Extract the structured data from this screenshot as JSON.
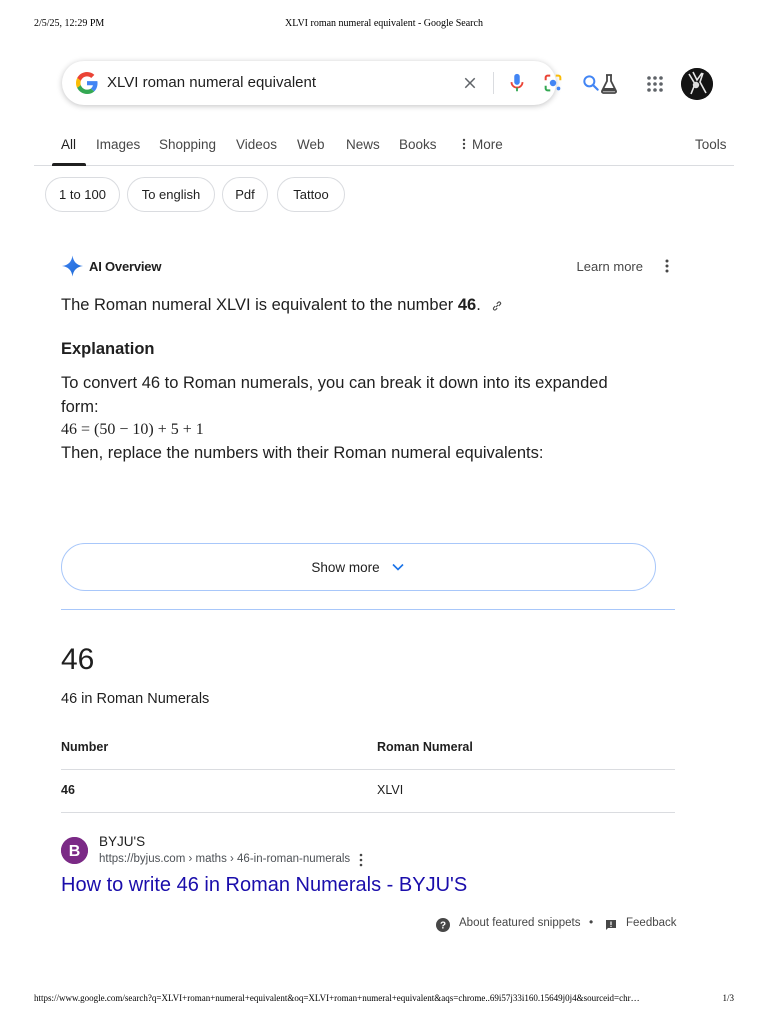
{
  "print_header": {
    "datetime": "2/5/25, 12:29 PM",
    "title": "XLVI roman numeral equivalent - Google Search"
  },
  "search": {
    "query": "XLVI roman numeral equivalent",
    "icons": [
      "google-logo-icon",
      "clear-icon",
      "mic-icon",
      "lens-icon",
      "search-icon"
    ]
  },
  "top_icons": [
    "labs-flask-icon",
    "apps-grid-icon",
    "avatar"
  ],
  "tabs": [
    {
      "label": "All",
      "active": true
    },
    {
      "label": "Images"
    },
    {
      "label": "Shopping"
    },
    {
      "label": "Videos"
    },
    {
      "label": "Web"
    },
    {
      "label": "News"
    },
    {
      "label": "Books"
    },
    {
      "label": "More",
      "icon": "more-vert-icon"
    }
  ],
  "tools_label": "Tools",
  "chips": [
    "1 to 100",
    "To english",
    "Pdf",
    "Tattoo"
  ],
  "ai_overview": {
    "title": "AI Overview",
    "learn_more": "Learn more",
    "answer_prefix": "The Roman numeral XLVI is equivalent to the number ",
    "answer_number": "46",
    "answer_suffix": ".",
    "explanation_heading": "Explanation",
    "explanation_text": "To convert 46 to Roman numerals, you can break it down into its expanded form:",
    "formula": "46 = (50 − 10) + 5 + 1",
    "then_text": "Then, replace the numbers with their Roman numeral equivalents:",
    "show_more": "Show more"
  },
  "snippet": {
    "big_number": "46",
    "subtitle": "46 in Roman Numerals",
    "table": {
      "headers": [
        "Number",
        "Roman Numeral"
      ],
      "rows": [
        [
          "46",
          "XLVI"
        ]
      ]
    },
    "source_name": "BYJU'S",
    "source_url": "https://byjus.com › maths › 46-in-roman-numerals",
    "result_title": "How to write 46 in Roman Numerals - BYJU'S",
    "about_label": "About featured snippets",
    "separator": "•",
    "feedback_label": "Feedback"
  },
  "colors": {
    "link_blue": "#1a0dab",
    "google_blue": "#4285F4",
    "google_red": "#EA4335",
    "google_yellow": "#FBBC05",
    "google_green": "#34A853",
    "byjus_purple": "#7b2a86",
    "show_more_border": "#a8c7fa"
  },
  "print_footer": {
    "url": "https://www.google.com/search?q=XLVI+roman+numeral+equivalent&oq=XLVI+roman+numeral+equivalent&aqs=chrome..69i57j33i160.15649j0j4&sourceid=chr…",
    "page": "1/3"
  }
}
